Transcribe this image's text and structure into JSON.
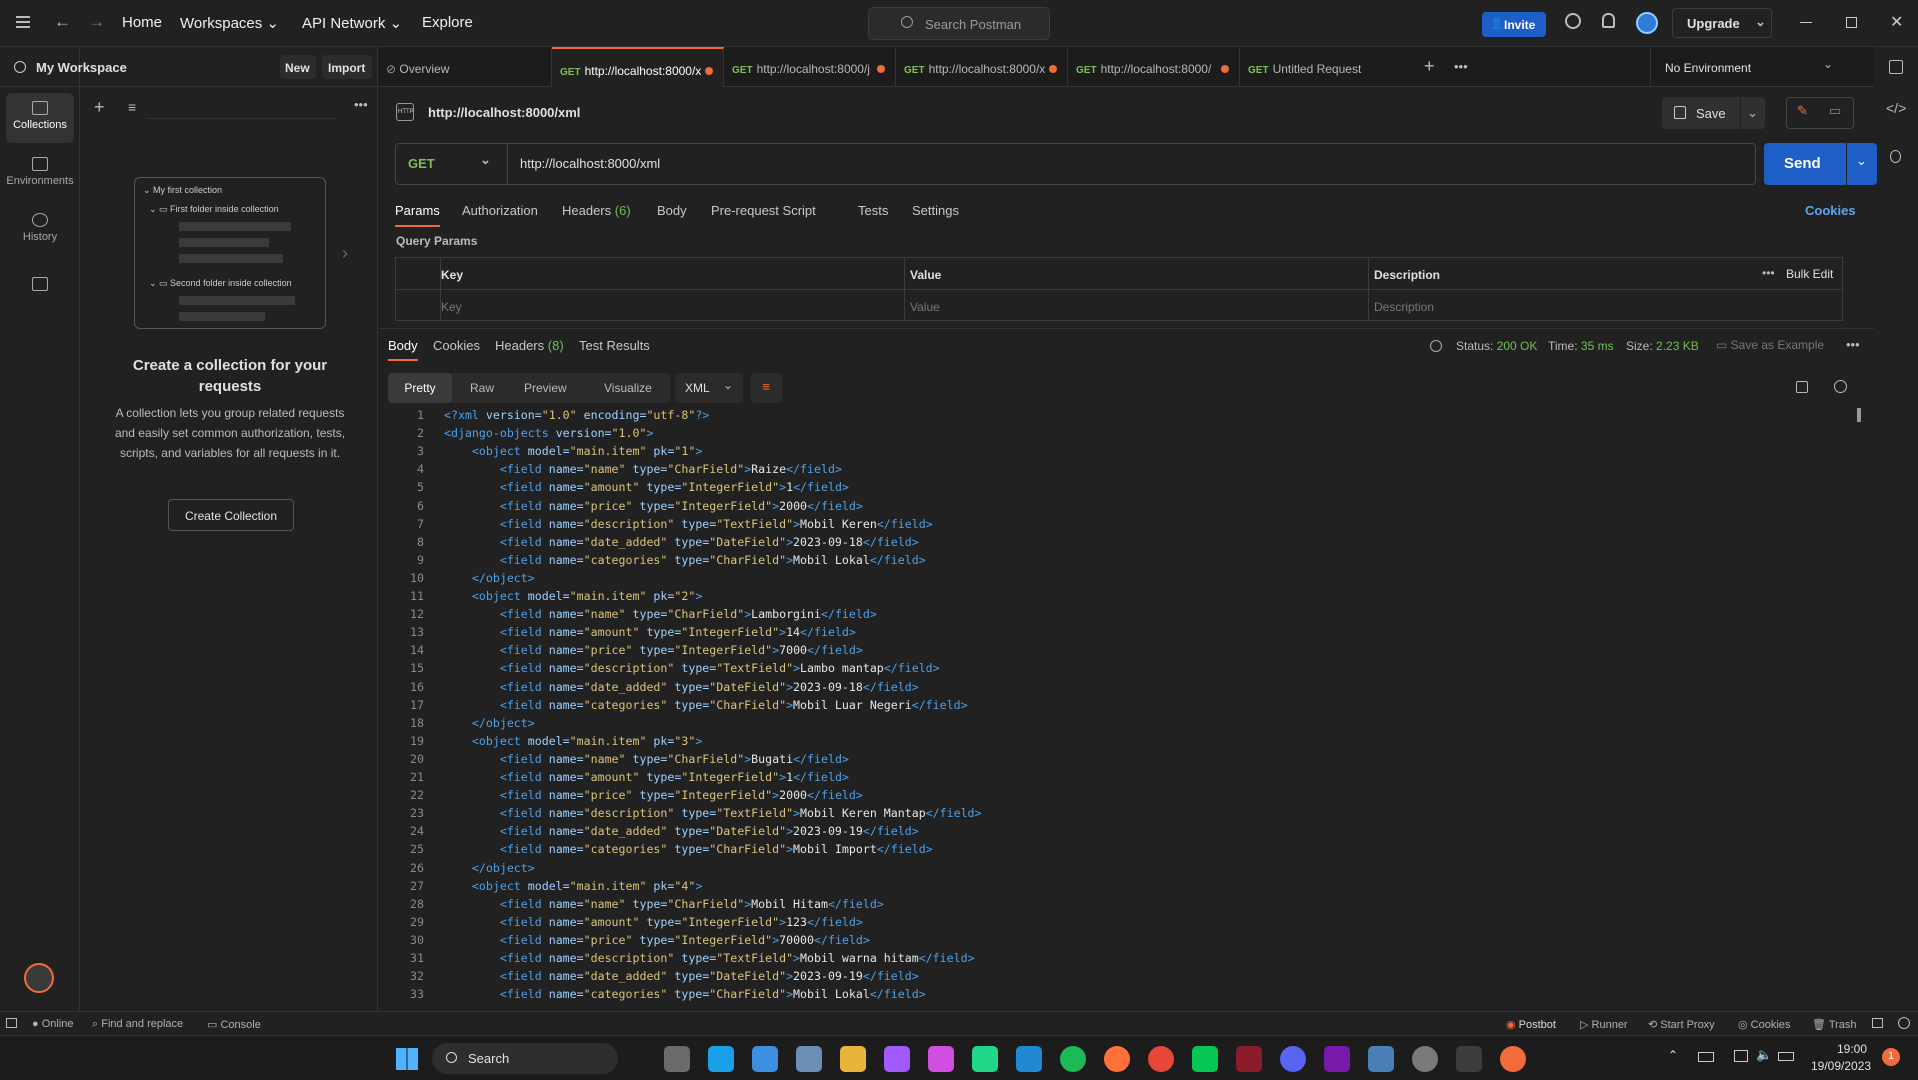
{
  "nav": {
    "home": "Home",
    "workspaces": "Workspaces",
    "api_network": "API Network",
    "explore": "Explore",
    "search": "Search Postman",
    "invite": "Invite",
    "upgrade": "Upgrade"
  },
  "workspace": {
    "name": "My Workspace",
    "new": "New",
    "import": "Import"
  },
  "sidebar": {
    "items": [
      {
        "label": "Collections"
      },
      {
        "label": "Environments"
      },
      {
        "label": "History"
      }
    ]
  },
  "empty": {
    "title": "Create a collection for your requests",
    "body": "A collection lets you group related requests and easily set common authorization, tests, scripts, and variables for all requests in it.",
    "button": "Create Collection",
    "tree": {
      "root": "My first collection",
      "f1": "First folder inside collection",
      "f2": "Second folder inside collection"
    }
  },
  "tabs": [
    {
      "label": "Overview",
      "method": ""
    },
    {
      "method": "GET",
      "label": "http://localhost:8000/x"
    },
    {
      "method": "GET",
      "label": "http://localhost:8000/j"
    },
    {
      "method": "GET",
      "label": "http://localhost:8000/x"
    },
    {
      "method": "GET",
      "label": "http://localhost:8000/"
    },
    {
      "method": "GET",
      "label": "Untitled Request"
    }
  ],
  "environment": "No Environment",
  "request": {
    "title": "http://localhost:8000/xml",
    "method": "GET",
    "url": "http://localhost:8000/xml",
    "save": "Save",
    "send": "Send",
    "cookies": "Cookies"
  },
  "req_tabs": [
    "Params",
    "Authorization",
    "Headers",
    "(6)",
    "Body",
    "Pre-request Script",
    "Tests",
    "Settings"
  ],
  "params": {
    "heading": "Query Params",
    "cols": [
      "Key",
      "Value",
      "Description"
    ],
    "bulk": "Bulk Edit",
    "placeholders": [
      "Key",
      "Value",
      "Description"
    ]
  },
  "resp_tabs": [
    "Body",
    "Cookies",
    "Headers",
    "(8)",
    "Test Results"
  ],
  "resp_meta": {
    "status_label": "Status:",
    "status": "200 OK",
    "time_label": "Time:",
    "time": "35 ms",
    "size_label": "Size:",
    "size": "2.23 KB",
    "save_example": "Save as Example"
  },
  "view_tabs": [
    "Pretty",
    "Raw",
    "Preview",
    "Visualize"
  ],
  "format": "XML",
  "code_lines": [
    [
      [
        "tg",
        "<?xml "
      ],
      [
        "at",
        "version="
      ],
      [
        "vl",
        "\"1.0\""
      ],
      [
        "at",
        " encoding="
      ],
      [
        "vl",
        "\"utf-8\""
      ],
      [
        "tg",
        "?>"
      ]
    ],
    [
      [
        "tg",
        "<django-objects "
      ],
      [
        "at",
        "version="
      ],
      [
        "vl",
        "\"1.0\""
      ],
      [
        "tg",
        ">"
      ]
    ],
    [
      [
        "tx",
        "    "
      ],
      [
        "tg",
        "<object "
      ],
      [
        "at",
        "model="
      ],
      [
        "vl",
        "\"main.item\""
      ],
      [
        "at",
        " pk="
      ],
      [
        "vl",
        "\"1\""
      ],
      [
        "tg",
        ">"
      ]
    ],
    [
      [
        "tx",
        "        "
      ],
      [
        "tg",
        "<field "
      ],
      [
        "at",
        "name="
      ],
      [
        "vl",
        "\"name\""
      ],
      [
        "at",
        " type="
      ],
      [
        "vl",
        "\"CharField\""
      ],
      [
        "tg",
        ">"
      ],
      [
        "tx",
        "Raize"
      ],
      [
        "tg",
        "</field>"
      ]
    ],
    [
      [
        "tx",
        "        "
      ],
      [
        "tg",
        "<field "
      ],
      [
        "at",
        "name="
      ],
      [
        "vl",
        "\"amount\""
      ],
      [
        "at",
        " type="
      ],
      [
        "vl",
        "\"IntegerField\""
      ],
      [
        "tg",
        ">"
      ],
      [
        "tx",
        "1"
      ],
      [
        "tg",
        "</field>"
      ]
    ],
    [
      [
        "tx",
        "        "
      ],
      [
        "tg",
        "<field "
      ],
      [
        "at",
        "name="
      ],
      [
        "vl",
        "\"price\""
      ],
      [
        "at",
        " type="
      ],
      [
        "vl",
        "\"IntegerField\""
      ],
      [
        "tg",
        ">"
      ],
      [
        "tx",
        "2000"
      ],
      [
        "tg",
        "</field>"
      ]
    ],
    [
      [
        "tx",
        "        "
      ],
      [
        "tg",
        "<field "
      ],
      [
        "at",
        "name="
      ],
      [
        "vl",
        "\"description\""
      ],
      [
        "at",
        " type="
      ],
      [
        "vl",
        "\"TextField\""
      ],
      [
        "tg",
        ">"
      ],
      [
        "tx",
        "Mobil Keren"
      ],
      [
        "tg",
        "</field>"
      ]
    ],
    [
      [
        "tx",
        "        "
      ],
      [
        "tg",
        "<field "
      ],
      [
        "at",
        "name="
      ],
      [
        "vl",
        "\"date_added\""
      ],
      [
        "at",
        " type="
      ],
      [
        "vl",
        "\"DateField\""
      ],
      [
        "tg",
        ">"
      ],
      [
        "tx",
        "2023-09-18"
      ],
      [
        "tg",
        "</field>"
      ]
    ],
    [
      [
        "tx",
        "        "
      ],
      [
        "tg",
        "<field "
      ],
      [
        "at",
        "name="
      ],
      [
        "vl",
        "\"categories\""
      ],
      [
        "at",
        " type="
      ],
      [
        "vl",
        "\"CharField\""
      ],
      [
        "tg",
        ">"
      ],
      [
        "tx",
        "Mobil Lokal"
      ],
      [
        "tg",
        "</field>"
      ]
    ],
    [
      [
        "tx",
        "    "
      ],
      [
        "tg",
        "</object>"
      ]
    ],
    [
      [
        "tx",
        "    "
      ],
      [
        "tg",
        "<object "
      ],
      [
        "at",
        "model="
      ],
      [
        "vl",
        "\"main.item\""
      ],
      [
        "at",
        " pk="
      ],
      [
        "vl",
        "\"2\""
      ],
      [
        "tg",
        ">"
      ]
    ],
    [
      [
        "tx",
        "        "
      ],
      [
        "tg",
        "<field "
      ],
      [
        "at",
        "name="
      ],
      [
        "vl",
        "\"name\""
      ],
      [
        "at",
        " type="
      ],
      [
        "vl",
        "\"CharField\""
      ],
      [
        "tg",
        ">"
      ],
      [
        "tx",
        "Lamborgini"
      ],
      [
        "tg",
        "</field>"
      ]
    ],
    [
      [
        "tx",
        "        "
      ],
      [
        "tg",
        "<field "
      ],
      [
        "at",
        "name="
      ],
      [
        "vl",
        "\"amount\""
      ],
      [
        "at",
        " type="
      ],
      [
        "vl",
        "\"IntegerField\""
      ],
      [
        "tg",
        ">"
      ],
      [
        "tx",
        "14"
      ],
      [
        "tg",
        "</field>"
      ]
    ],
    [
      [
        "tx",
        "        "
      ],
      [
        "tg",
        "<field "
      ],
      [
        "at",
        "name="
      ],
      [
        "vl",
        "\"price\""
      ],
      [
        "at",
        " type="
      ],
      [
        "vl",
        "\"IntegerField\""
      ],
      [
        "tg",
        ">"
      ],
      [
        "tx",
        "7000"
      ],
      [
        "tg",
        "</field>"
      ]
    ],
    [
      [
        "tx",
        "        "
      ],
      [
        "tg",
        "<field "
      ],
      [
        "at",
        "name="
      ],
      [
        "vl",
        "\"description\""
      ],
      [
        "at",
        " type="
      ],
      [
        "vl",
        "\"TextField\""
      ],
      [
        "tg",
        ">"
      ],
      [
        "tx",
        "Lambo mantap"
      ],
      [
        "tg",
        "</field>"
      ]
    ],
    [
      [
        "tx",
        "        "
      ],
      [
        "tg",
        "<field "
      ],
      [
        "at",
        "name="
      ],
      [
        "vl",
        "\"date_added\""
      ],
      [
        "at",
        " type="
      ],
      [
        "vl",
        "\"DateField\""
      ],
      [
        "tg",
        ">"
      ],
      [
        "tx",
        "2023-09-18"
      ],
      [
        "tg",
        "</field>"
      ]
    ],
    [
      [
        "tx",
        "        "
      ],
      [
        "tg",
        "<field "
      ],
      [
        "at",
        "name="
      ],
      [
        "vl",
        "\"categories\""
      ],
      [
        "at",
        " type="
      ],
      [
        "vl",
        "\"CharField\""
      ],
      [
        "tg",
        ">"
      ],
      [
        "tx",
        "Mobil Luar Negeri"
      ],
      [
        "tg",
        "</field>"
      ]
    ],
    [
      [
        "tx",
        "    "
      ],
      [
        "tg",
        "</object>"
      ]
    ],
    [
      [
        "tx",
        "    "
      ],
      [
        "tg",
        "<object "
      ],
      [
        "at",
        "model="
      ],
      [
        "vl",
        "\"main.item\""
      ],
      [
        "at",
        " pk="
      ],
      [
        "vl",
        "\"3\""
      ],
      [
        "tg",
        ">"
      ]
    ],
    [
      [
        "tx",
        "        "
      ],
      [
        "tg",
        "<field "
      ],
      [
        "at",
        "name="
      ],
      [
        "vl",
        "\"name\""
      ],
      [
        "at",
        " type="
      ],
      [
        "vl",
        "\"CharField\""
      ],
      [
        "tg",
        ">"
      ],
      [
        "tx",
        "Bugati"
      ],
      [
        "tg",
        "</field>"
      ]
    ],
    [
      [
        "tx",
        "        "
      ],
      [
        "tg",
        "<field "
      ],
      [
        "at",
        "name="
      ],
      [
        "vl",
        "\"amount\""
      ],
      [
        "at",
        " type="
      ],
      [
        "vl",
        "\"IntegerField\""
      ],
      [
        "tg",
        ">"
      ],
      [
        "tx",
        "1"
      ],
      [
        "tg",
        "</field>"
      ]
    ],
    [
      [
        "tx",
        "        "
      ],
      [
        "tg",
        "<field "
      ],
      [
        "at",
        "name="
      ],
      [
        "vl",
        "\"price\""
      ],
      [
        "at",
        " type="
      ],
      [
        "vl",
        "\"IntegerField\""
      ],
      [
        "tg",
        ">"
      ],
      [
        "tx",
        "2000"
      ],
      [
        "tg",
        "</field>"
      ]
    ],
    [
      [
        "tx",
        "        "
      ],
      [
        "tg",
        "<field "
      ],
      [
        "at",
        "name="
      ],
      [
        "vl",
        "\"description\""
      ],
      [
        "at",
        " type="
      ],
      [
        "vl",
        "\"TextField\""
      ],
      [
        "tg",
        ">"
      ],
      [
        "tx",
        "Mobil Keren Mantap"
      ],
      [
        "tg",
        "</field>"
      ]
    ],
    [
      [
        "tx",
        "        "
      ],
      [
        "tg",
        "<field "
      ],
      [
        "at",
        "name="
      ],
      [
        "vl",
        "\"date_added\""
      ],
      [
        "at",
        " type="
      ],
      [
        "vl",
        "\"DateField\""
      ],
      [
        "tg",
        ">"
      ],
      [
        "tx",
        "2023-09-19"
      ],
      [
        "tg",
        "</field>"
      ]
    ],
    [
      [
        "tx",
        "        "
      ],
      [
        "tg",
        "<field "
      ],
      [
        "at",
        "name="
      ],
      [
        "vl",
        "\"categories\""
      ],
      [
        "at",
        " type="
      ],
      [
        "vl",
        "\"CharField\""
      ],
      [
        "tg",
        ">"
      ],
      [
        "tx",
        "Mobil Import"
      ],
      [
        "tg",
        "</field>"
      ]
    ],
    [
      [
        "tx",
        "    "
      ],
      [
        "tg",
        "</object>"
      ]
    ],
    [
      [
        "tx",
        "    "
      ],
      [
        "tg",
        "<object "
      ],
      [
        "at",
        "model="
      ],
      [
        "vl",
        "\"main.item\""
      ],
      [
        "at",
        " pk="
      ],
      [
        "vl",
        "\"4\""
      ],
      [
        "tg",
        ">"
      ]
    ],
    [
      [
        "tx",
        "        "
      ],
      [
        "tg",
        "<field "
      ],
      [
        "at",
        "name="
      ],
      [
        "vl",
        "\"name\""
      ],
      [
        "at",
        " type="
      ],
      [
        "vl",
        "\"CharField\""
      ],
      [
        "tg",
        ">"
      ],
      [
        "tx",
        "Mobil Hitam"
      ],
      [
        "tg",
        "</field>"
      ]
    ],
    [
      [
        "tx",
        "        "
      ],
      [
        "tg",
        "<field "
      ],
      [
        "at",
        "name="
      ],
      [
        "vl",
        "\"amount\""
      ],
      [
        "at",
        " type="
      ],
      [
        "vl",
        "\"IntegerField\""
      ],
      [
        "tg",
        ">"
      ],
      [
        "tx",
        "123"
      ],
      [
        "tg",
        "</field>"
      ]
    ],
    [
      [
        "tx",
        "        "
      ],
      [
        "tg",
        "<field "
      ],
      [
        "at",
        "name="
      ],
      [
        "vl",
        "\"price\""
      ],
      [
        "at",
        " type="
      ],
      [
        "vl",
        "\"IntegerField\""
      ],
      [
        "tg",
        ">"
      ],
      [
        "tx",
        "70000"
      ],
      [
        "tg",
        "</field>"
      ]
    ],
    [
      [
        "tx",
        "        "
      ],
      [
        "tg",
        "<field "
      ],
      [
        "at",
        "name="
      ],
      [
        "vl",
        "\"description\""
      ],
      [
        "at",
        " type="
      ],
      [
        "vl",
        "\"TextField\""
      ],
      [
        "tg",
        ">"
      ],
      [
        "tx",
        "Mobil warna hitam"
      ],
      [
        "tg",
        "</field>"
      ]
    ],
    [
      [
        "tx",
        "        "
      ],
      [
        "tg",
        "<field "
      ],
      [
        "at",
        "name="
      ],
      [
        "vl",
        "\"date_added\""
      ],
      [
        "at",
        " type="
      ],
      [
        "vl",
        "\"DateField\""
      ],
      [
        "tg",
        ">"
      ],
      [
        "tx",
        "2023-09-19"
      ],
      [
        "tg",
        "</field>"
      ]
    ],
    [
      [
        "tx",
        "        "
      ],
      [
        "tg",
        "<field "
      ],
      [
        "at",
        "name="
      ],
      [
        "vl",
        "\"categories\""
      ],
      [
        "at",
        " type="
      ],
      [
        "vl",
        "\"CharField\""
      ],
      [
        "tg",
        ">"
      ],
      [
        "tx",
        "Mobil Lokal"
      ],
      [
        "tg",
        "</field>"
      ]
    ]
  ],
  "statusbar": {
    "online": "Online",
    "find": "Find and replace",
    "console": "Console",
    "postbot": "Postbot",
    "runner": "Runner",
    "proxy": "Start Proxy",
    "cookies": "Cookies",
    "trash": "Trash"
  },
  "taskbar": {
    "search": "Search",
    "time": "19:00",
    "date": "19/09/2023",
    "badge": "1"
  },
  "colors": {
    "accent": "#f26b3a",
    "send": "#1d5ec7",
    "ok": "#6cc24a"
  }
}
